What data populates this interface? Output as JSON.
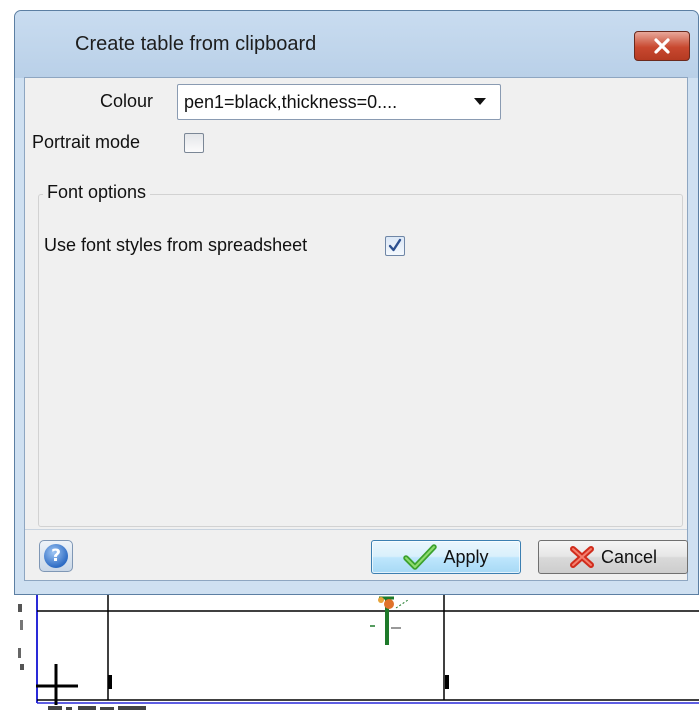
{
  "dialog": {
    "title": "Create table from clipboard",
    "close_icon": "close-x-icon"
  },
  "form": {
    "colour_label": "Colour",
    "colour_value": "pen1=black,thickness=0....",
    "portrait_label": "Portrait mode",
    "portrait_checked": false
  },
  "font_options": {
    "legend": "Font options",
    "use_styles_label": "Use font styles from spreadsheet",
    "use_styles_checked": true
  },
  "footer": {
    "help_icon": "help-icon",
    "help_symbol": "?",
    "apply_label": "Apply",
    "apply_icon": "checkmark-icon",
    "cancel_label": "Cancel",
    "cancel_icon": "cancel-x-icon"
  },
  "colors": {
    "title_bar": "#b9d0e8",
    "close_button": "#c8482f",
    "apply_accent": "#3c7fb1",
    "check_green": "#3ba12e",
    "cancel_red": "#d12c1c"
  }
}
